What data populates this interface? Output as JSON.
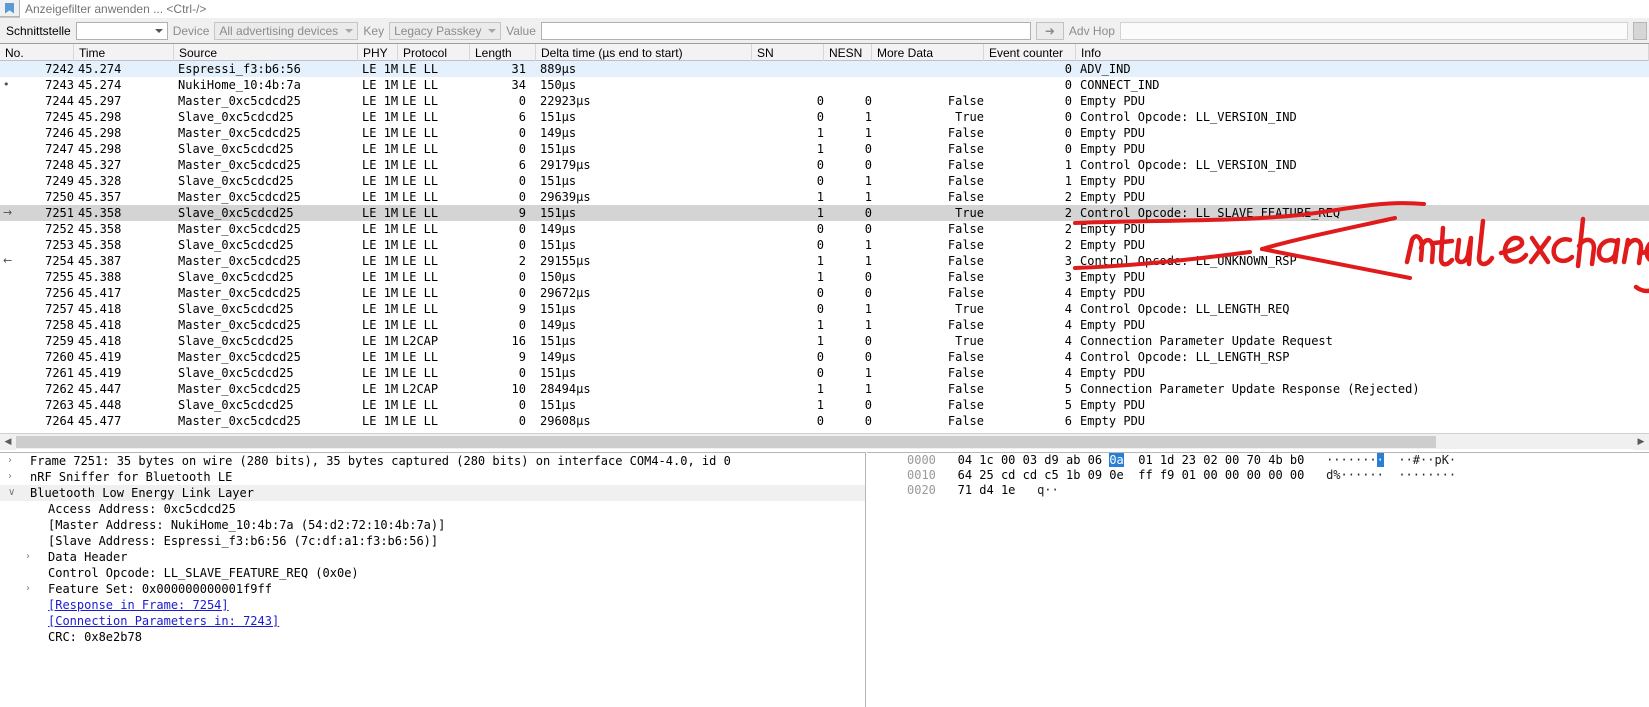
{
  "filter_bar": {
    "bookmark_icon": "bookmark-icon",
    "placeholder": "Anzeigefilter anwenden ... <Ctrl-/>",
    "value": ""
  },
  "toolbar": {
    "interface_label": "Schnittstelle",
    "interface_value": "",
    "device_label": "Device",
    "device_value": "All advertising devices",
    "key_label": "Key",
    "key_value": "Legacy Passkey",
    "value_label": "Value",
    "value_value": "",
    "go_icon": "arrow-right-icon",
    "adv_hop_label": "Adv Hop",
    "adv_hop_value": ""
  },
  "packet_list": {
    "columns": [
      {
        "key": "no",
        "label": "No."
      },
      {
        "key": "time",
        "label": "Time"
      },
      {
        "key": "source",
        "label": "Source"
      },
      {
        "key": "phy",
        "label": "PHY"
      },
      {
        "key": "protocol",
        "label": "Protocol"
      },
      {
        "key": "length",
        "label": "Length"
      },
      {
        "key": "delta",
        "label": "Delta time (µs end to start)"
      },
      {
        "key": "sn",
        "label": "SN"
      },
      {
        "key": "nesn",
        "label": "NESN"
      },
      {
        "key": "more_data",
        "label": "More Data"
      },
      {
        "key": "event_counter",
        "label": "Event counter"
      },
      {
        "key": "info",
        "label": "Info"
      }
    ],
    "rows": [
      {
        "no": "7242",
        "time": "45.274",
        "source": "Espressi_f3:b6:56",
        "phy": "LE 1M",
        "protocol": "LE LL",
        "length": "31",
        "delta": "889µs",
        "sn": "",
        "nesn": "",
        "more_data": "",
        "event_counter": "0",
        "info": "ADV_IND",
        "state": "sel-blue",
        "marker": ""
      },
      {
        "no": "7243",
        "time": "45.274",
        "source": "NukiHome_10:4b:7a",
        "phy": "LE 1M",
        "protocol": "LE LL",
        "length": "34",
        "delta": "150µs",
        "sn": "",
        "nesn": "",
        "more_data": "",
        "event_counter": "0",
        "info": "CONNECT_IND",
        "state": "",
        "marker": "•"
      },
      {
        "no": "7244",
        "time": "45.297",
        "source": "Master_0xc5cdcd25",
        "phy": "LE 1M",
        "protocol": "LE LL",
        "length": "0",
        "delta": "22923µs",
        "sn": "0",
        "nesn": "0",
        "more_data": "False",
        "event_counter": "0",
        "info": "Empty PDU",
        "state": "",
        "marker": ""
      },
      {
        "no": "7245",
        "time": "45.298",
        "source": "Slave_0xc5cdcd25",
        "phy": "LE 1M",
        "protocol": "LE LL",
        "length": "6",
        "delta": "151µs",
        "sn": "0",
        "nesn": "1",
        "more_data": "True",
        "event_counter": "0",
        "info": "Control Opcode: LL_VERSION_IND",
        "state": "",
        "marker": ""
      },
      {
        "no": "7246",
        "time": "45.298",
        "source": "Master_0xc5cdcd25",
        "phy": "LE 1M",
        "protocol": "LE LL",
        "length": "0",
        "delta": "149µs",
        "sn": "1",
        "nesn": "1",
        "more_data": "False",
        "event_counter": "0",
        "info": "Empty PDU",
        "state": "",
        "marker": ""
      },
      {
        "no": "7247",
        "time": "45.298",
        "source": "Slave_0xc5cdcd25",
        "phy": "LE 1M",
        "protocol": "LE LL",
        "length": "0",
        "delta": "151µs",
        "sn": "1",
        "nesn": "0",
        "more_data": "False",
        "event_counter": "0",
        "info": "Empty PDU",
        "state": "",
        "marker": ""
      },
      {
        "no": "7248",
        "time": "45.327",
        "source": "Master_0xc5cdcd25",
        "phy": "LE 1M",
        "protocol": "LE LL",
        "length": "6",
        "delta": "29179µs",
        "sn": "0",
        "nesn": "0",
        "more_data": "False",
        "event_counter": "1",
        "info": "Control Opcode: LL_VERSION_IND",
        "state": "",
        "marker": ""
      },
      {
        "no": "7249",
        "time": "45.328",
        "source": "Slave_0xc5cdcd25",
        "phy": "LE 1M",
        "protocol": "LE LL",
        "length": "0",
        "delta": "151µs",
        "sn": "0",
        "nesn": "1",
        "more_data": "False",
        "event_counter": "1",
        "info": "Empty PDU",
        "state": "",
        "marker": ""
      },
      {
        "no": "7250",
        "time": "45.357",
        "source": "Master_0xc5cdcd25",
        "phy": "LE 1M",
        "protocol": "LE LL",
        "length": "0",
        "delta": "29639µs",
        "sn": "1",
        "nesn": "1",
        "more_data": "False",
        "event_counter": "2",
        "info": "Empty PDU",
        "state": "",
        "marker": ""
      },
      {
        "no": "7251",
        "time": "45.358",
        "source": "Slave_0xc5cdcd25",
        "phy": "LE 1M",
        "protocol": "LE LL",
        "length": "9",
        "delta": "151µs",
        "sn": "1",
        "nesn": "0",
        "more_data": "True",
        "event_counter": "2",
        "info": "Control Opcode: LL_SLAVE_FEATURE_REQ",
        "state": "sel-grey",
        "marker": "→"
      },
      {
        "no": "7252",
        "time": "45.358",
        "source": "Master_0xc5cdcd25",
        "phy": "LE 1M",
        "protocol": "LE LL",
        "length": "0",
        "delta": "149µs",
        "sn": "0",
        "nesn": "0",
        "more_data": "False",
        "event_counter": "2",
        "info": "Empty PDU",
        "state": "",
        "marker": ""
      },
      {
        "no": "7253",
        "time": "45.358",
        "source": "Slave_0xc5cdcd25",
        "phy": "LE 1M",
        "protocol": "LE LL",
        "length": "0",
        "delta": "151µs",
        "sn": "0",
        "nesn": "1",
        "more_data": "False",
        "event_counter": "2",
        "info": "Empty PDU",
        "state": "",
        "marker": ""
      },
      {
        "no": "7254",
        "time": "45.387",
        "source": "Master_0xc5cdcd25",
        "phy": "LE 1M",
        "protocol": "LE LL",
        "length": "2",
        "delta": "29155µs",
        "sn": "1",
        "nesn": "1",
        "more_data": "False",
        "event_counter": "3",
        "info": "Control Opcode: LL_UNKNOWN_RSP",
        "state": "",
        "marker": "←"
      },
      {
        "no": "7255",
        "time": "45.388",
        "source": "Slave_0xc5cdcd25",
        "phy": "LE 1M",
        "protocol": "LE LL",
        "length": "0",
        "delta": "150µs",
        "sn": "1",
        "nesn": "0",
        "more_data": "False",
        "event_counter": "3",
        "info": "Empty PDU",
        "state": "",
        "marker": ""
      },
      {
        "no": "7256",
        "time": "45.417",
        "source": "Master_0xc5cdcd25",
        "phy": "LE 1M",
        "protocol": "LE LL",
        "length": "0",
        "delta": "29672µs",
        "sn": "0",
        "nesn": "0",
        "more_data": "False",
        "event_counter": "4",
        "info": "Empty PDU",
        "state": "",
        "marker": ""
      },
      {
        "no": "7257",
        "time": "45.418",
        "source": "Slave_0xc5cdcd25",
        "phy": "LE 1M",
        "protocol": "LE LL",
        "length": "9",
        "delta": "151µs",
        "sn": "0",
        "nesn": "1",
        "more_data": "True",
        "event_counter": "4",
        "info": "Control Opcode: LL_LENGTH_REQ",
        "state": "",
        "marker": ""
      },
      {
        "no": "7258",
        "time": "45.418",
        "source": "Master_0xc5cdcd25",
        "phy": "LE 1M",
        "protocol": "LE LL",
        "length": "0",
        "delta": "149µs",
        "sn": "1",
        "nesn": "1",
        "more_data": "False",
        "event_counter": "4",
        "info": "Empty PDU",
        "state": "",
        "marker": ""
      },
      {
        "no": "7259",
        "time": "45.418",
        "source": "Slave_0xc5cdcd25",
        "phy": "LE 1M",
        "protocol": "L2CAP",
        "length": "16",
        "delta": "151µs",
        "sn": "1",
        "nesn": "0",
        "more_data": "True",
        "event_counter": "4",
        "info": "Connection Parameter Update Request",
        "state": "",
        "marker": ""
      },
      {
        "no": "7260",
        "time": "45.419",
        "source": "Master_0xc5cdcd25",
        "phy": "LE 1M",
        "protocol": "LE LL",
        "length": "9",
        "delta": "149µs",
        "sn": "0",
        "nesn": "0",
        "more_data": "False",
        "event_counter": "4",
        "info": "Control Opcode: LL_LENGTH_RSP",
        "state": "",
        "marker": ""
      },
      {
        "no": "7261",
        "time": "45.419",
        "source": "Slave_0xc5cdcd25",
        "phy": "LE 1M",
        "protocol": "LE LL",
        "length": "0",
        "delta": "151µs",
        "sn": "0",
        "nesn": "1",
        "more_data": "False",
        "event_counter": "4",
        "info": "Empty PDU",
        "state": "",
        "marker": ""
      },
      {
        "no": "7262",
        "time": "45.447",
        "source": "Master_0xc5cdcd25",
        "phy": "LE 1M",
        "protocol": "L2CAP",
        "length": "10",
        "delta": "28494µs",
        "sn": "1",
        "nesn": "1",
        "more_data": "False",
        "event_counter": "5",
        "info": "Connection Parameter Update Response (Rejected)",
        "state": "",
        "marker": ""
      },
      {
        "no": "7263",
        "time": "45.448",
        "source": "Slave_0xc5cdcd25",
        "phy": "LE 1M",
        "protocol": "LE LL",
        "length": "0",
        "delta": "151µs",
        "sn": "1",
        "nesn": "0",
        "more_data": "False",
        "event_counter": "5",
        "info": "Empty PDU",
        "state": "",
        "marker": ""
      },
      {
        "no": "7264",
        "time": "45.477",
        "source": "Master_0xc5cdcd25",
        "phy": "LE 1M",
        "protocol": "LE LL",
        "length": "0",
        "delta": "29608µs",
        "sn": "0",
        "nesn": "0",
        "more_data": "False",
        "event_counter": "6",
        "info": "Empty PDU",
        "state": "",
        "marker": ""
      }
    ],
    "hscroll": {
      "left_icon": "chevron-left-icon",
      "right_icon": "chevron-right-icon"
    }
  },
  "detail_pane": {
    "rows": [
      {
        "text": "Frame 7251: 35 bytes on wire (280 bits), 35 bytes captured (280 bits) on interface COM4-4.0, id 0",
        "indent": 0,
        "twisty": "›",
        "link": false,
        "hl": false
      },
      {
        "text": "nRF Sniffer for Bluetooth LE",
        "indent": 0,
        "twisty": "›",
        "link": false,
        "hl": false
      },
      {
        "text": "Bluetooth Low Energy Link Layer",
        "indent": 0,
        "twisty": "∨",
        "link": false,
        "hl": true
      },
      {
        "text": "Access Address: 0xc5cdcd25",
        "indent": 1,
        "twisty": "",
        "link": false,
        "hl": false
      },
      {
        "text": "[Master Address: NukiHome_10:4b:7a (54:d2:72:10:4b:7a)]",
        "indent": 1,
        "twisty": "",
        "link": false,
        "hl": false
      },
      {
        "text": "[Slave Address: Espressi_f3:b6:56 (7c:df:a1:f3:b6:56)]",
        "indent": 1,
        "twisty": "",
        "link": false,
        "hl": false
      },
      {
        "text": "Data Header",
        "indent": 1,
        "twisty": "›",
        "link": false,
        "hl": false
      },
      {
        "text": "Control Opcode: LL_SLAVE_FEATURE_REQ (0x0e)",
        "indent": 1,
        "twisty": "",
        "link": false,
        "hl": false
      },
      {
        "text": "Feature Set: 0x000000000001f9ff",
        "indent": 1,
        "twisty": "›",
        "link": false,
        "hl": false
      },
      {
        "text": "[Response in Frame: 7254]",
        "indent": 1,
        "twisty": "",
        "link": true,
        "hl": false
      },
      {
        "text": "[Connection Parameters in: 7243]",
        "indent": 1,
        "twisty": "",
        "link": true,
        "hl": false
      },
      {
        "text": "CRC: 0x8e2b78",
        "indent": 1,
        "twisty": "",
        "link": false,
        "hl": false
      }
    ]
  },
  "bytes_pane": {
    "rows": [
      {
        "offset": "0000",
        "hex_a": "04 1c 00 03 d9 ab 06 ",
        "hex_sel": "0a",
        "hex_b": "  01 1d 23 02 00 70 4b b0",
        "ascii_a": "·······",
        "ascii_sel": "·",
        "ascii_b": "  ··#··pK·"
      },
      {
        "offset": "0010",
        "hex_a": "64 25 cd cd c5 1b 09 0e",
        "hex_sel": "",
        "hex_b": "  ff f9 01 00 00 00 00 00",
        "ascii_a": "d%······",
        "ascii_sel": "",
        "ascii_b": "  ········"
      },
      {
        "offset": "0020",
        "hex_a": "71 d4 1e",
        "hex_sel": "",
        "hex_b": "",
        "ascii_a": "q··",
        "ascii_sel": "",
        "ascii_b": ""
      }
    ]
  },
  "annotation": {
    "text": "mtu exchange",
    "color": "#e01b1b"
  }
}
